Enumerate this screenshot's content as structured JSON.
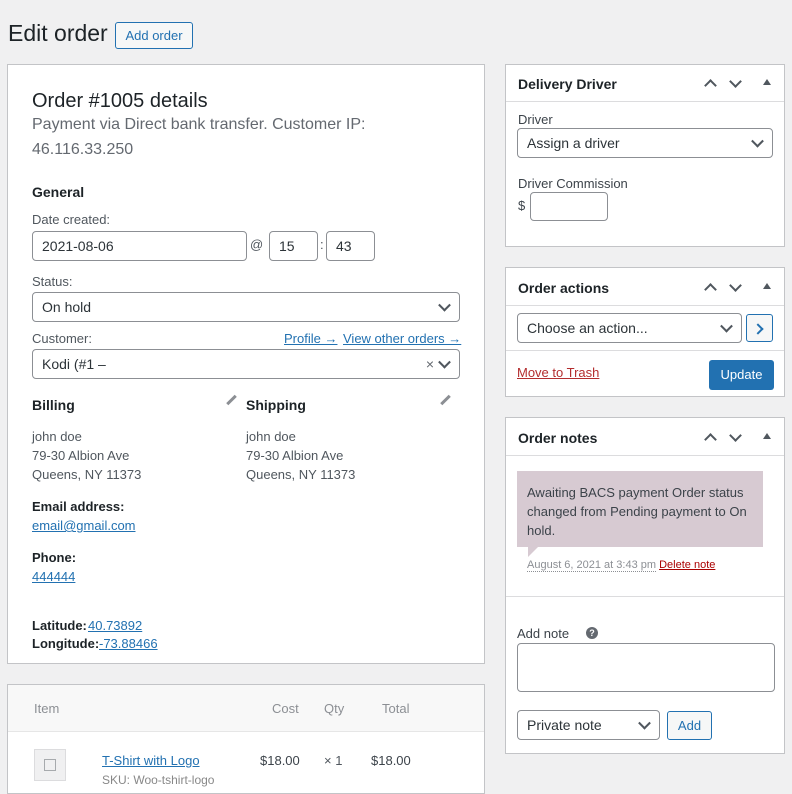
{
  "page": {
    "title": "Edit order",
    "add_button": "Add order"
  },
  "order": {
    "heading": "Order #1005 details",
    "payment_line1": "Payment via Direct bank transfer. Customer IP:",
    "payment_line2": "46.116.33.250",
    "general_title": "General",
    "date_label": "Date created:",
    "date_value": "2021-08-06",
    "at_symbol": "@",
    "hour": "15",
    "time_sep": ":",
    "minute": "43",
    "status_label": "Status:",
    "status_value": "On hold",
    "customer_label": "Customer:",
    "profile_link": "Profile →",
    "view_orders_link": "View other orders →",
    "customer_value": "Kodi (#1 –",
    "clear_symbol": "×",
    "billing": {
      "title": "Billing",
      "name": "john doe",
      "street": "79-30 Albion Ave",
      "city": "Queens, NY 11373"
    },
    "shipping": {
      "title": "Shipping",
      "name": "john doe",
      "street": "79-30 Albion Ave",
      "city": "Queens, NY 11373"
    },
    "email_label": "Email address:",
    "email": "email@gmail.com",
    "phone_label": "Phone:",
    "phone": "444444",
    "latitude_label": "Latitude:",
    "latitude": "40.73892",
    "longitude_label": "Longitude:",
    "longitude": "-73.88466"
  },
  "items": {
    "headers": {
      "item": "Item",
      "cost": "Cost",
      "qty": "Qty",
      "total": "Total"
    },
    "rows": [
      {
        "name": "T-Shirt with Logo",
        "sku": "SKU: Woo-tshirt-logo",
        "cost": "$18.00",
        "qty": "× 1",
        "total": "$18.00"
      }
    ]
  },
  "delivery": {
    "title": "Delivery Driver",
    "driver_label": "Driver",
    "driver_value": "Assign a driver",
    "commission_label": "Driver Commission",
    "currency": "$",
    "commission_value": ""
  },
  "actions": {
    "title": "Order actions",
    "select_value": "Choose an action...",
    "trash_link": "Move to Trash",
    "update_button": "Update"
  },
  "notes": {
    "title": "Order notes",
    "note_text": "Awaiting BACS payment Order status changed from Pending payment to On hold.",
    "note_date": "August 6, 2021 at 3:43 pm",
    "delete_link": "Delete note",
    "add_note_label": "Add note",
    "help_symbol": "?",
    "note_type": "Private note",
    "add_button": "Add"
  }
}
